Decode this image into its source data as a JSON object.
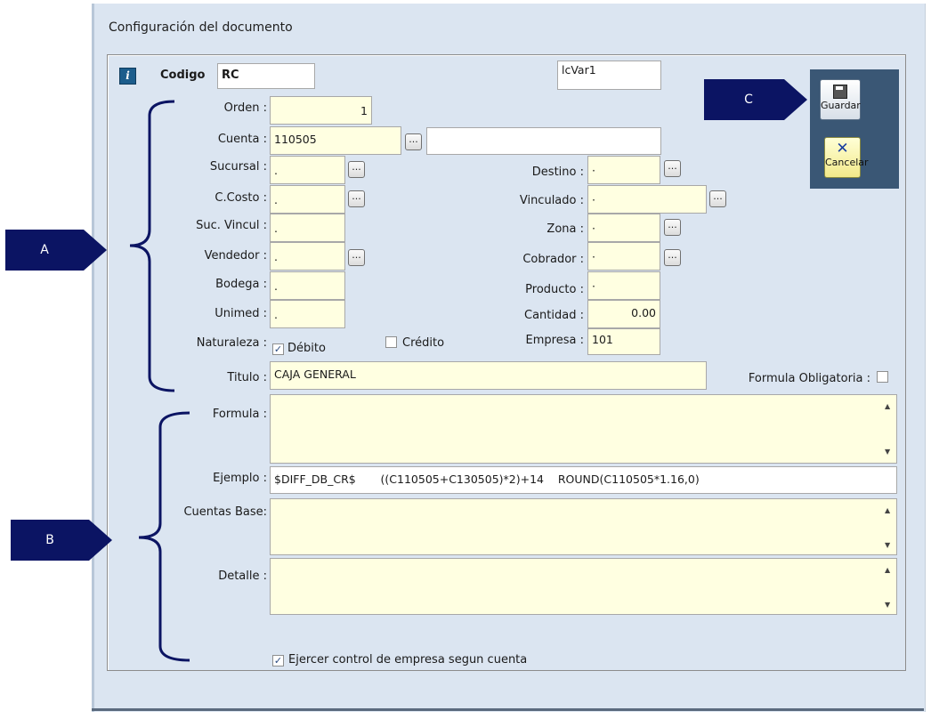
{
  "window": {
    "title": "Configuración del documento"
  },
  "header": {
    "codigo_label": "Codigo",
    "codigo_value": "RC",
    "var_value": "lcVar1"
  },
  "toolbar": {
    "save_label": "Guardar",
    "cancel_label": "Cancelar"
  },
  "callouts": {
    "a": "A",
    "b": "B",
    "c": "C"
  },
  "left": {
    "orden_label": "Orden :",
    "orden_value": "1",
    "cuenta_label": "Cuenta :",
    "cuenta_value": "110505",
    "cuenta_desc": "",
    "sucursal_label": "Sucursal :",
    "sucursal_value": ".",
    "ccosto_label": "C.Costo :",
    "ccosto_value": ".",
    "sucvincul_label": "Suc. Vincul :",
    "sucvincul_value": ".",
    "vendedor_label": "Vendedor :",
    "vendedor_value": ".",
    "bodega_label": "Bodega :",
    "bodega_value": ".",
    "unimed_label": "Unimed :",
    "unimed_value": ".",
    "naturaleza_label": "Naturaleza :",
    "debito_label": "Débito",
    "credito_label": "Crédito",
    "titulo_label": "Titulo :",
    "titulo_value": "CAJA GENERAL"
  },
  "right": {
    "destino_label": "Destino :",
    "destino_value": "·",
    "vinculado_label": "Vinculado :",
    "vinculado_value": "·",
    "zona_label": "Zona :",
    "zona_value": "·",
    "cobrador_label": "Cobrador :",
    "cobrador_value": "·",
    "producto_label": "Producto :",
    "producto_value": "·",
    "cantidad_label": "Cantidad :",
    "cantidad_value": "0.00",
    "empresa_label": "Empresa :",
    "empresa_value": "101",
    "formula_obligatoria_label": "Formula Obligatoria :"
  },
  "lower": {
    "formula_label": "Formula :",
    "ejemplo_label": "Ejemplo :",
    "ejemplo_value": "$DIFF_DB_CR$       ((C110505+C130505)*2)+14    ROUND(C110505*1.16,0)",
    "cuentas_base_label": "Cuentas Base:",
    "detalle_label": "Detalle :",
    "control_label": "Ejercer control de empresa segun cuenta"
  },
  "checks": {
    "debito": true,
    "credito": false,
    "formula_obligatoria": false,
    "control": true
  },
  "colors": {
    "field_bg": "#ffffe1",
    "callout": "#0b1463",
    "window_bg": "#dbe5f1",
    "button_panel": "#3a5775"
  }
}
